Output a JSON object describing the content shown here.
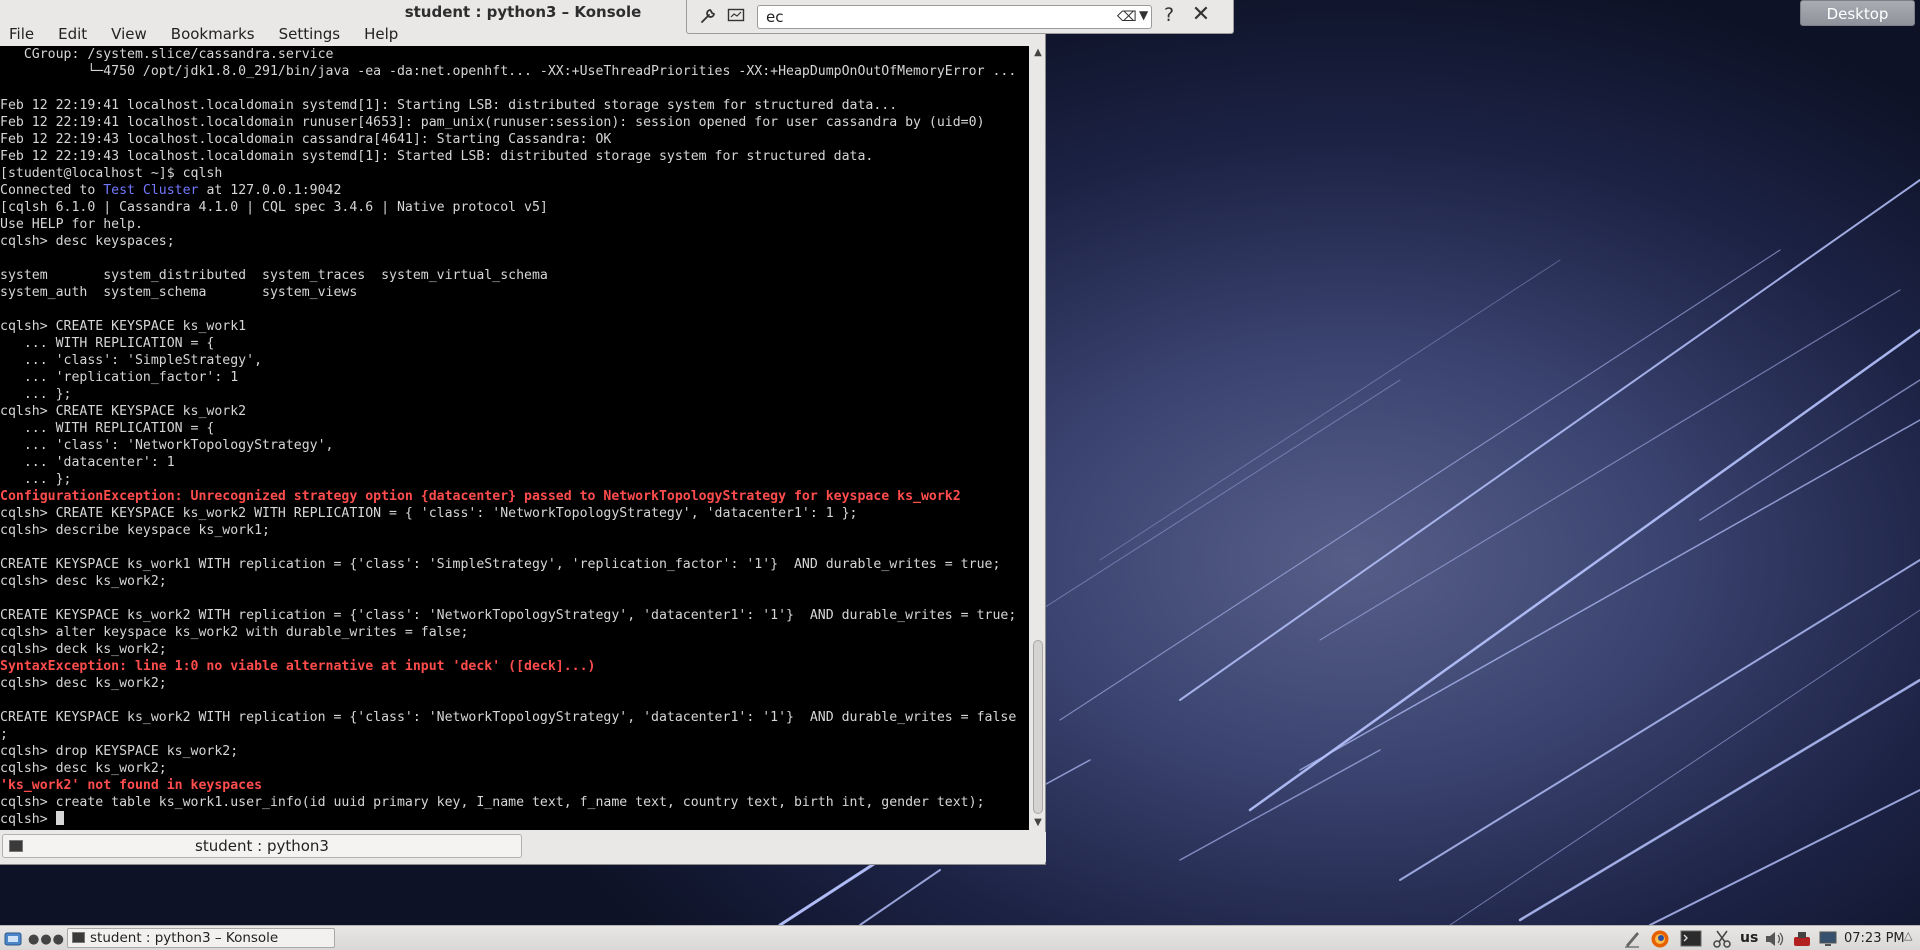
{
  "window": {
    "title": "student : python3 – Konsole",
    "menu": [
      "File",
      "Edit",
      "View",
      "Bookmarks",
      "Settings",
      "Help"
    ],
    "tab_label": "student : python3"
  },
  "search": {
    "value": "ec"
  },
  "desktop": {
    "label": "Desktop"
  },
  "terminal": {
    "lines": [
      {
        "text": "   CGroup: /system.slice/cassandra.service",
        "style": "normal"
      },
      {
        "text": "           └─4750 /opt/jdk1.8.0_291/bin/java -ea -da:net.openhft... -XX:+UseThreadPriorities -XX:+HeapDumpOnOutOfMemoryError ...",
        "style": "normal"
      },
      {
        "text": "",
        "style": "normal"
      },
      {
        "text": "Feb 12 22:19:41 localhost.localdomain systemd[1]: Starting LSB: distributed storage system for structured data...",
        "style": "normal"
      },
      {
        "text": "Feb 12 22:19:41 localhost.localdomain runuser[4653]: pam_unix(runuser:session): session opened for user cassandra by (uid=0)",
        "style": "normal"
      },
      {
        "text": "Feb 12 22:19:43 localhost.localdomain cassandra[4641]: Starting Cassandra: OK",
        "style": "normal"
      },
      {
        "text": "Feb 12 22:19:43 localhost.localdomain systemd[1]: Started LSB: distributed storage system for structured data.",
        "style": "normal"
      },
      {
        "text": "[student@localhost ~]$ cqlsh",
        "style": "normal"
      },
      {
        "text": "Connected to |Test Cluster| at 127.0.0.1:9042",
        "style": "highlight"
      },
      {
        "text": "[cqlsh 6.1.0 | Cassandra 4.1.0 | CQL spec 3.4.6 | Native protocol v5]",
        "style": "normal"
      },
      {
        "text": "Use HELP for help.",
        "style": "normal"
      },
      {
        "text": "cqlsh> desc keyspaces;",
        "style": "normal"
      },
      {
        "text": "",
        "style": "normal"
      },
      {
        "text": "system       system_distributed  system_traces  system_virtual_schema",
        "style": "normal"
      },
      {
        "text": "system_auth  system_schema       system_views",
        "style": "normal"
      },
      {
        "text": "",
        "style": "normal"
      },
      {
        "text": "cqlsh> CREATE KEYSPACE ks_work1",
        "style": "normal"
      },
      {
        "text": "   ... WITH REPLICATION = {",
        "style": "normal"
      },
      {
        "text": "   ... 'class': 'SimpleStrategy',",
        "style": "normal"
      },
      {
        "text": "   ... 'replication_factor': 1",
        "style": "normal"
      },
      {
        "text": "   ... };",
        "style": "normal"
      },
      {
        "text": "cqlsh> CREATE KEYSPACE ks_work2",
        "style": "normal"
      },
      {
        "text": "   ... WITH REPLICATION = {",
        "style": "normal"
      },
      {
        "text": "   ... 'class': 'NetworkTopologyStrategy',",
        "style": "normal"
      },
      {
        "text": "   ... 'datacenter': 1",
        "style": "normal"
      },
      {
        "text": "   ... };",
        "style": "normal"
      },
      {
        "text": "ConfigurationException: Unrecognized strategy option {datacenter} passed to NetworkTopologyStrategy for keyspace ks_work2",
        "style": "error"
      },
      {
        "text": "cqlsh> CREATE KEYSPACE ks_work2 WITH REPLICATION = { 'class': 'NetworkTopologyStrategy', 'datacenter1': 1 };",
        "style": "normal"
      },
      {
        "text": "cqlsh> describe keyspace ks_work1;",
        "style": "normal"
      },
      {
        "text": "",
        "style": "normal"
      },
      {
        "text": "CREATE KEYSPACE ks_work1 WITH replication = {'class': 'SimpleStrategy', 'replication_factor': '1'}  AND durable_writes = true;",
        "style": "normal"
      },
      {
        "text": "cqlsh> desc ks_work2;",
        "style": "normal"
      },
      {
        "text": "",
        "style": "normal"
      },
      {
        "text": "CREATE KEYSPACE ks_work2 WITH replication = {'class': 'NetworkTopologyStrategy', 'datacenter1': '1'}  AND durable_writes = true;",
        "style": "normal"
      },
      {
        "text": "cqlsh> alter keyspace ks_work2 with durable_writes = false;",
        "style": "normal"
      },
      {
        "text": "cqlsh> deck ks_work2;",
        "style": "normal"
      },
      {
        "text": "SyntaxException: line 1:0 no viable alternative at input 'deck' ([deck]...)",
        "style": "error"
      },
      {
        "text": "cqlsh> desc ks_work2;",
        "style": "normal"
      },
      {
        "text": "",
        "style": "normal"
      },
      {
        "text": "CREATE KEYSPACE ks_work2 WITH replication = {'class': 'NetworkTopologyStrategy', 'datacenter1': '1'}  AND durable_writes = false",
        "style": "normal"
      },
      {
        "text": ";",
        "style": "normal"
      },
      {
        "text": "cqlsh> drop KEYSPACE ks_work2;",
        "style": "normal"
      },
      {
        "text": "cqlsh> desc ks_work2;",
        "style": "normal"
      },
      {
        "text": "'ks_work2' not found in keyspaces",
        "style": "error"
      },
      {
        "text": "cqlsh> create table ks_work1.user_info(id uuid primary key, I_name text, f_name text, country text, birth int, gender text);",
        "style": "normal"
      },
      {
        "text": "cqlsh> ",
        "style": "prompt"
      }
    ]
  },
  "taskbar": {
    "task_label": "student : python3 – Konsole",
    "keyboard_layout": "us",
    "clock": "07:23 PM"
  },
  "colors": {
    "error": "#ff4c4c",
    "highlight": "#7377ff",
    "terminal_bg": "#000000",
    "terminal_fg": "#d6d6d6"
  }
}
